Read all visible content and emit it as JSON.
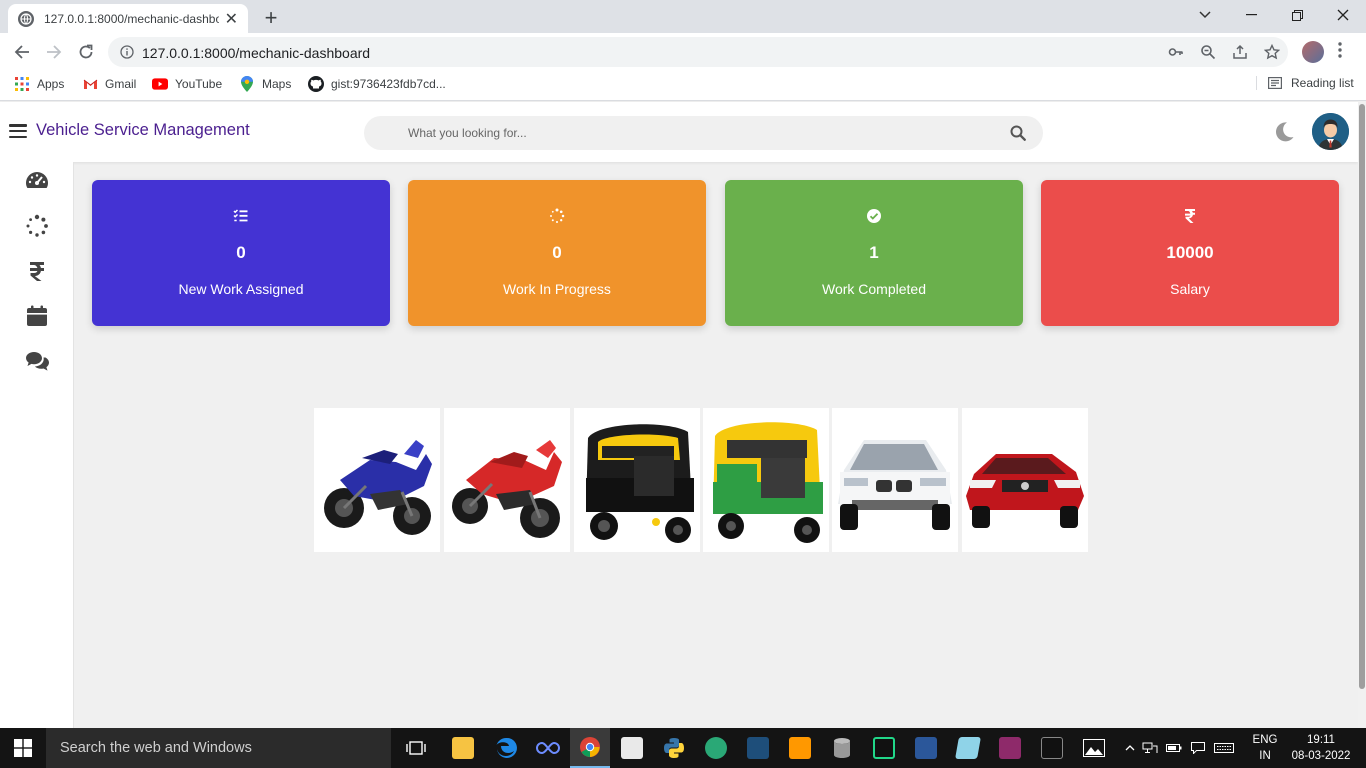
{
  "browser": {
    "tab_title": "127.0.0.1:8000/mechanic-dashboard",
    "tab_close": "✕",
    "new_tab": "+",
    "url": "127.0.0.1:8000/mechanic-dashboard",
    "bookmarks": [
      {
        "label": "Apps",
        "icon": "apps-grid-icon"
      },
      {
        "label": "Gmail",
        "icon": "gmail-icon"
      },
      {
        "label": "YouTube",
        "icon": "youtube-icon"
      },
      {
        "label": "Maps",
        "icon": "maps-icon"
      },
      {
        "label": "gist:9736423fdb7cd...",
        "icon": "github-icon"
      }
    ],
    "reading_list": "Reading list"
  },
  "header": {
    "brand": "Vehicle Service Management",
    "search_placeholder": "What you looking for..."
  },
  "sidebar": {
    "items": [
      {
        "name": "dashboard",
        "icon": "speedometer-icon"
      },
      {
        "name": "work-in-progress",
        "icon": "spinner-icon"
      },
      {
        "name": "salary",
        "icon": "rupee-icon"
      },
      {
        "name": "calendar",
        "icon": "calendar-icon"
      },
      {
        "name": "feedback",
        "icon": "chat-icon"
      }
    ]
  },
  "cards": [
    {
      "label": "New Work Assigned",
      "value": "0",
      "color": "#4433d3",
      "icon": "tasks-icon"
    },
    {
      "label": "Work In Progress",
      "value": "0",
      "color": "#f0932b",
      "icon": "spinner-icon"
    },
    {
      "label": "Work Completed",
      "value": "1",
      "color": "#6ab04c",
      "icon": "check-circle-icon"
    },
    {
      "label": "Salary",
      "value": "10000",
      "color": "#eb4d4b",
      "icon": "rupee-icon"
    }
  ],
  "gallery": {
    "vehicles": [
      "blue-motorcycle",
      "red-motorcycle",
      "black-auto-rickshaw",
      "green-auto-rickshaw",
      "white-suv",
      "red-sedan"
    ]
  },
  "taskbar": {
    "search_text": "Search the web and Windows",
    "lang_line1": "ENG",
    "lang_line2": "IN",
    "time": "19:11",
    "date": "08-03-2022"
  }
}
